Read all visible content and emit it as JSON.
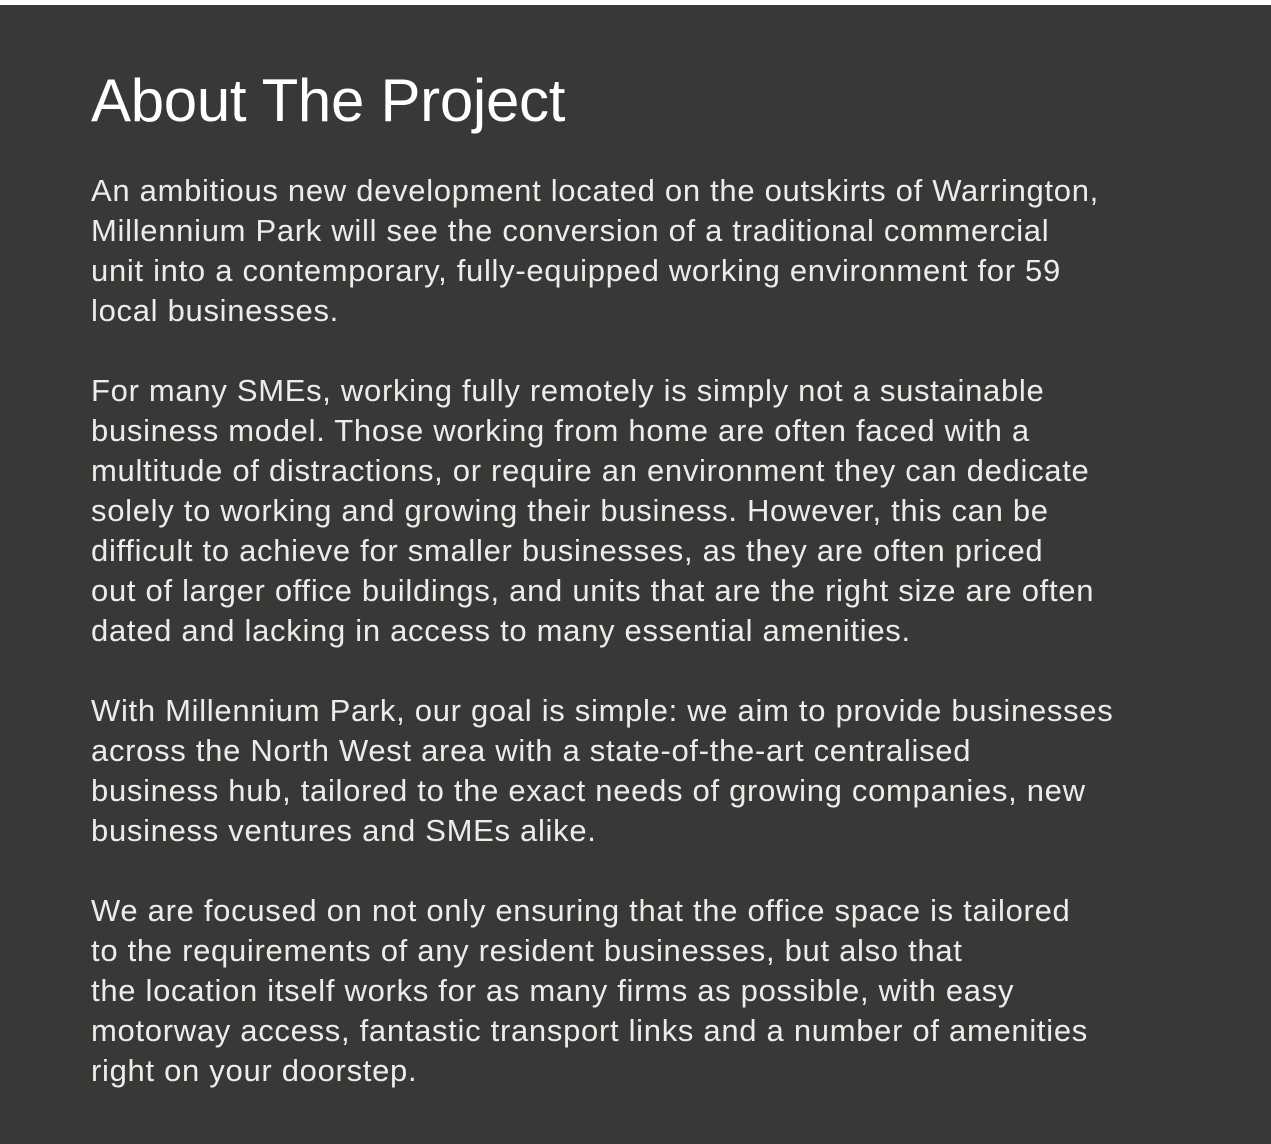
{
  "section": {
    "title": "About The Project",
    "paragraphs": [
      {
        "lines": [
          "An ambitious new development located on the outskirts of Warrington,",
          "Millennium Park will see the conversion of a traditional commercial",
          "unit into a contemporary, fully-equipped working environment for 59",
          "local businesses."
        ]
      },
      {
        "lines": [
          "For many SMEs, working fully remotely is simply not a sustainable",
          "business model. Those working from home are often faced with a",
          "multitude of distractions, or require an environment they can dedicate",
          "solely to working and growing their business. However, this can be",
          "difficult to achieve for smaller businesses, as they are often priced",
          "out of larger office buildings, and units that are the right size are often",
          "dated and lacking in access to many essential amenities."
        ]
      },
      {
        "lines": [
          "With Millennium Park, our goal is simple: we aim to provide businesses",
          "across the North West area with a state-of-the-art centralised",
          "business hub, tailored to the exact needs of growing companies, new",
          "business ventures and SMEs alike."
        ]
      },
      {
        "lines": [
          "We are focused on not only ensuring that the office space is tailored",
          "to the requirements of any resident businesses, but also that",
          "the location itself works for as many firms as possible, with easy",
          "motorway access, fantastic transport links and a number of amenities",
          "right on your doorstep."
        ]
      }
    ]
  },
  "colors": {
    "panel_background": "#383836",
    "title_text": "#ffffff",
    "body_text": "#ececea"
  }
}
